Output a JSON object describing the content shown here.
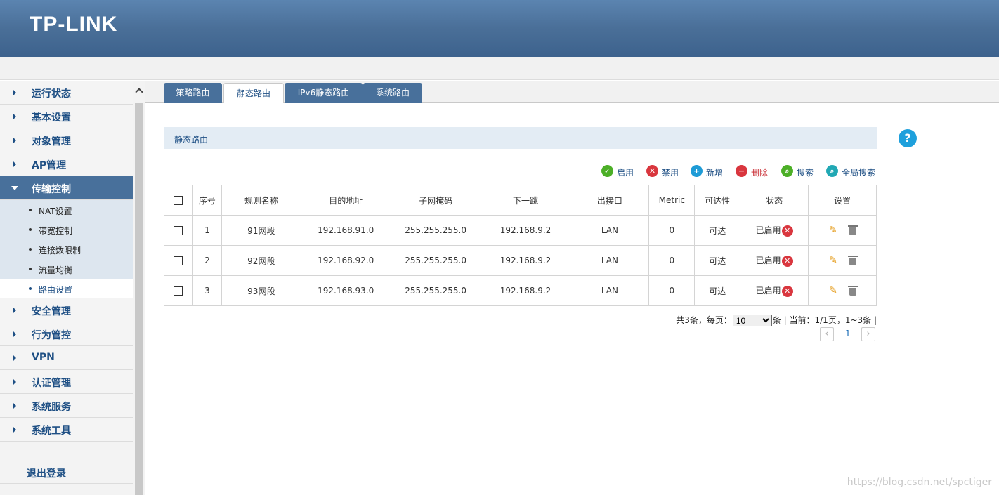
{
  "header": {
    "brand": "TP-LINK"
  },
  "sidebar": {
    "items": [
      {
        "label": "运行状态"
      },
      {
        "label": "基本设置"
      },
      {
        "label": "对象管理"
      },
      {
        "label": "AP管理"
      },
      {
        "label": "传输控制"
      },
      {
        "label": "安全管理"
      },
      {
        "label": "行为管控"
      },
      {
        "label": "VPN"
      },
      {
        "label": "认证管理"
      },
      {
        "label": "系统服务"
      },
      {
        "label": "系统工具"
      }
    ],
    "subitems": [
      {
        "label": "NAT设置"
      },
      {
        "label": "带宽控制"
      },
      {
        "label": "连接数限制"
      },
      {
        "label": "流量均衡"
      },
      {
        "label": "路由设置"
      }
    ],
    "logout": "退出登录"
  },
  "tabs": [
    {
      "label": "策略路由"
    },
    {
      "label": "静态路由"
    },
    {
      "label": "IPv6静态路由"
    },
    {
      "label": "系统路由"
    }
  ],
  "section": {
    "title": "静态路由",
    "help": "?"
  },
  "toolbar": {
    "enable": "启用",
    "disable": "禁用",
    "add": "新增",
    "delete": "删除",
    "search": "搜索",
    "global_search": "全局搜索"
  },
  "table": {
    "headers": [
      "序号",
      "规则名称",
      "目的地址",
      "子网掩码",
      "下一跳",
      "出接口",
      "Metric",
      "可达性",
      "状态",
      "设置"
    ],
    "rows": [
      {
        "index": "1",
        "name": "91网段",
        "dest": "192.168.91.0",
        "mask": "255.255.255.0",
        "next_hop": "192.168.9.2",
        "iface": "LAN",
        "metric": "0",
        "reach": "可达",
        "status": "已启用"
      },
      {
        "index": "2",
        "name": "92网段",
        "dest": "192.168.92.0",
        "mask": "255.255.255.0",
        "next_hop": "192.168.9.2",
        "iface": "LAN",
        "metric": "0",
        "reach": "可达",
        "status": "已启用"
      },
      {
        "index": "3",
        "name": "93网段",
        "dest": "192.168.93.0",
        "mask": "255.255.255.0",
        "next_hop": "192.168.9.2",
        "iface": "LAN",
        "metric": "0",
        "reach": "可达",
        "status": "已启用"
      }
    ]
  },
  "pager": {
    "total_text": "共3条，每页：",
    "per_page": "10",
    "suffix": "条 | 当前：1/1页，1~3条 |",
    "current_page": "1"
  },
  "watermark": "https://blog.csdn.net/spctiger",
  "colors": {
    "header": "#4a6f98",
    "accent": "#1e4f84",
    "danger": "#d9363e"
  }
}
